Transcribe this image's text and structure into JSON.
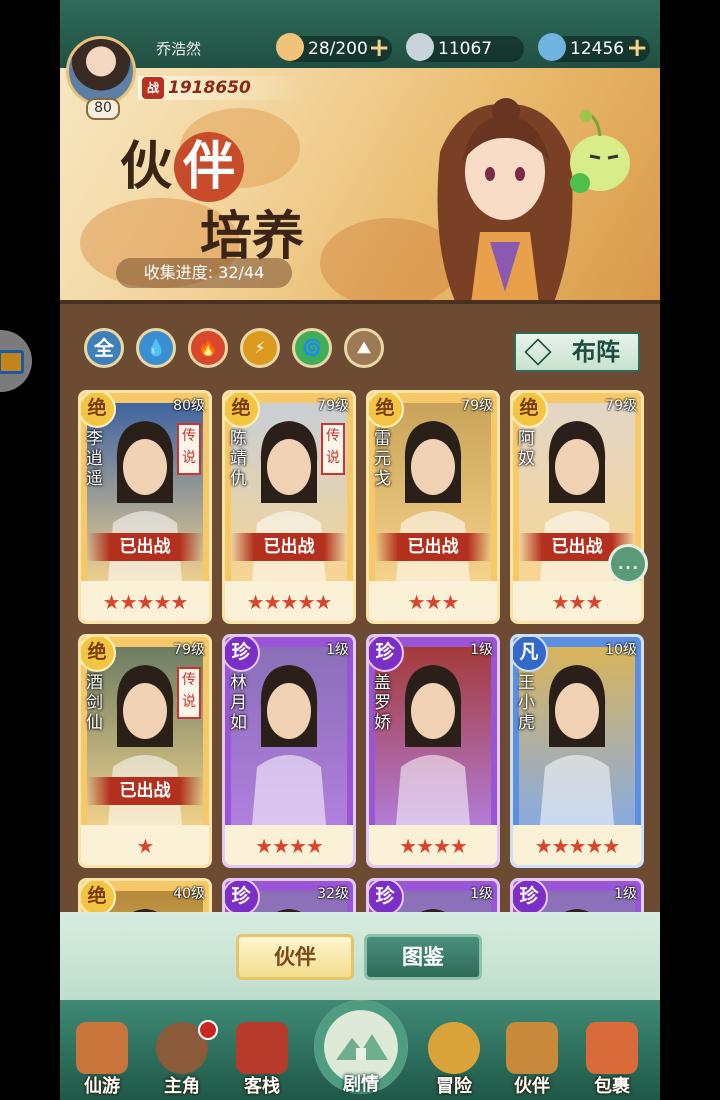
{
  "player": {
    "name": "乔浩然",
    "level": "80",
    "power": "1918650",
    "power_tag": "战"
  },
  "resources": [
    {
      "name": "stamina",
      "value": "28/200",
      "icon": "bun-icon",
      "color": "#f1c27a"
    },
    {
      "name": "silver",
      "value": "11067",
      "icon": "coin-icon",
      "color": "#c9d3da"
    },
    {
      "name": "jade",
      "value": "12456",
      "icon": "jade-icon",
      "color": "#6fb3e0"
    }
  ],
  "banner": {
    "title_a": "伙",
    "title_b": "伴",
    "title_c": "培养",
    "progress_label": "收集进度: 32/44"
  },
  "filters": [
    {
      "name": "all",
      "label": "全",
      "color": "#3f7fb8"
    },
    {
      "name": "water",
      "label": "💧",
      "color": "#3b8ed1"
    },
    {
      "name": "fire",
      "label": "🔥",
      "color": "#d9472c"
    },
    {
      "name": "thunder",
      "label": "⚡",
      "color": "#d99a1e"
    },
    {
      "name": "wind",
      "label": "🌀",
      "color": "#3fae55"
    },
    {
      "name": "earth",
      "label": "⛰",
      "color": "#9c7a58"
    }
  ],
  "deploy_label": "布阵",
  "cards": [
    {
      "name": "李逍遥",
      "level": "80级",
      "grade": "绝",
      "tier": "gold",
      "legend": "传说",
      "deployed": "已出战",
      "stars": "★★★★★",
      "bg": "#3f64a0"
    },
    {
      "name": "陈靖仇",
      "level": "79级",
      "grade": "绝",
      "tier": "gold",
      "legend": "传说",
      "deployed": "已出战",
      "stars": "★★★★★",
      "bg": "#c9cfd6"
    },
    {
      "name": "雷元戈",
      "level": "79级",
      "grade": "绝",
      "tier": "gold",
      "legend": "",
      "deployed": "已出战",
      "stars": "★★★",
      "bg": "#c9a35a"
    },
    {
      "name": "阿奴",
      "level": "79级",
      "grade": "绝",
      "tier": "gold",
      "legend": "",
      "deployed": "已出战",
      "stars": "★★★",
      "bg": "#e3d6c8"
    },
    {
      "name": "酒剑仙",
      "level": "79级",
      "grade": "绝",
      "tier": "gold",
      "legend": "传说",
      "deployed": "已出战",
      "stars": "★",
      "bg": "#6c7d63"
    },
    {
      "name": "林月如",
      "level": "1级",
      "grade": "珍",
      "tier": "purple",
      "legend": "",
      "deployed": "",
      "stars": "★★★★",
      "bg": "#8a6fb8"
    },
    {
      "name": "盖罗娇",
      "level": "1级",
      "grade": "珍",
      "tier": "purple",
      "legend": "",
      "deployed": "",
      "stars": "★★★★",
      "bg": "#a43a3a"
    },
    {
      "name": "王小虎",
      "level": "10级",
      "grade": "凡",
      "tier": "blue",
      "legend": "",
      "deployed": "",
      "stars": "★★★★★",
      "bg": "#d9b45a"
    },
    {
      "name": "",
      "level": "40级",
      "grade": "绝",
      "tier": "gold",
      "legend": "",
      "deployed": "",
      "stars": "",
      "bg": "#b58a3a"
    },
    {
      "name": "",
      "level": "32级",
      "grade": "珍",
      "tier": "purple",
      "legend": "",
      "deployed": "",
      "stars": "",
      "bg": "#8a6fb8"
    },
    {
      "name": "",
      "level": "1级",
      "grade": "珍",
      "tier": "purple",
      "legend": "",
      "deployed": "",
      "stars": "",
      "bg": "#8a6fb8"
    },
    {
      "name": "",
      "level": "1级",
      "grade": "珍",
      "tier": "purple",
      "legend": "",
      "deployed": "",
      "stars": "",
      "bg": "#8a6fb8"
    }
  ],
  "tabs": {
    "active": "伙伴",
    "inactive": "图鉴"
  },
  "nav": [
    {
      "label": "仙游",
      "icon": "scroll-icon",
      "color": "#c9743a"
    },
    {
      "label": "主角",
      "icon": "hero-portrait-icon",
      "color": "#8a5a3a"
    },
    {
      "label": "客栈",
      "icon": "inn-icon",
      "color": "#b83a2a"
    },
    {
      "label": "剧情",
      "icon": "story-landscape-icon",
      "color": "#4e9c82"
    },
    {
      "label": "冒险",
      "icon": "gourd-icon",
      "color": "#d9a33a"
    },
    {
      "label": "伙伴",
      "icon": "partner-cards-icon",
      "color": "#c88a3a"
    },
    {
      "label": "包裹",
      "icon": "bag-icon",
      "color": "#d96a3a"
    }
  ]
}
